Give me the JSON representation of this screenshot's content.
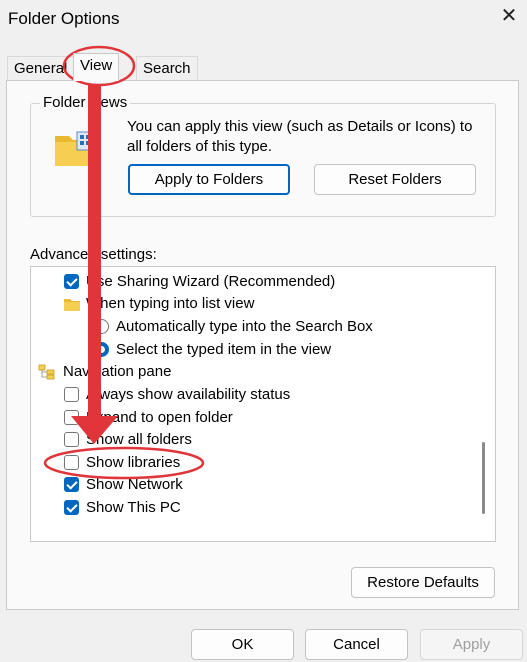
{
  "window": {
    "title": "Folder Options",
    "close_glyph": "✕"
  },
  "tabs": [
    {
      "label": "General"
    },
    {
      "label": "View"
    },
    {
      "label": "Search"
    }
  ],
  "folder_views": {
    "title": "Folder views",
    "description": "You can apply this view (such as Details or Icons) to all folders of this type.",
    "apply_label": "Apply to Folders",
    "reset_label": "Reset Folders"
  },
  "advanced": {
    "label": "Advanced settings:",
    "items": [
      {
        "type": "checkbox",
        "checked": true,
        "label": "Use Sharing Wizard (Recommended)"
      },
      {
        "type": "folder",
        "label": "When typing into list view"
      },
      {
        "type": "radio",
        "checked": false,
        "label": "Automatically type into the Search Box"
      },
      {
        "type": "radio",
        "checked": true,
        "label": "Select the typed item in the view"
      },
      {
        "type": "navpane",
        "label": "Navigation pane"
      },
      {
        "type": "checkbox",
        "checked": false,
        "label": "Always show availability status"
      },
      {
        "type": "checkbox",
        "checked": false,
        "label": "Expand to open folder"
      },
      {
        "type": "checkbox",
        "checked": false,
        "label": "Show all folders"
      },
      {
        "type": "checkbox",
        "checked": false,
        "label": "Show libraries"
      },
      {
        "type": "checkbox",
        "checked": true,
        "label": "Show Network"
      },
      {
        "type": "checkbox",
        "checked": true,
        "label": "Show This PC"
      }
    ],
    "restore_label": "Restore Defaults"
  },
  "footer": {
    "ok_label": "OK",
    "cancel_label": "Cancel",
    "apply_label": "Apply"
  },
  "colors": {
    "accent": "#0067c0",
    "annotation_red": "#e0353b",
    "folder_yellow": "#f4c542"
  }
}
